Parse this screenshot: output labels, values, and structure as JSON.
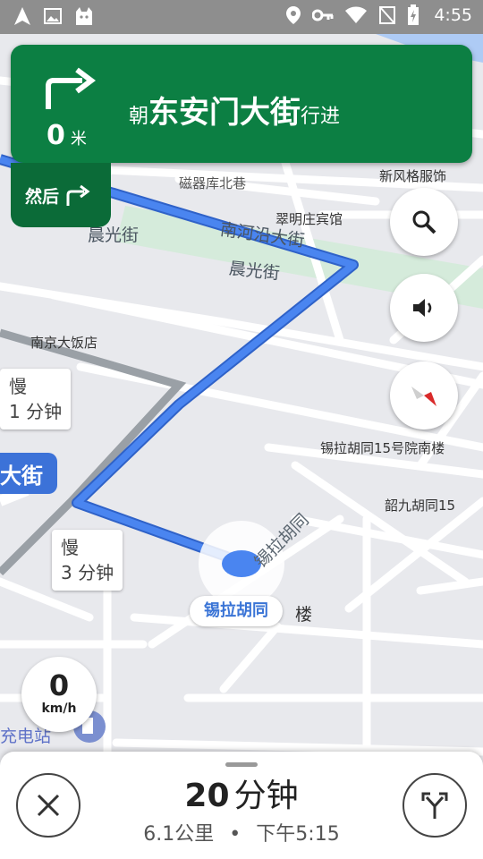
{
  "status_bar": {
    "time": "4:55",
    "left_icons": [
      "navigation-arrow-icon",
      "image-icon",
      "cat-app-icon"
    ],
    "right_icons": [
      "location-pin-icon",
      "key-icon",
      "wifi-icon",
      "no-sim-icon",
      "battery-charging-icon"
    ]
  },
  "banner": {
    "distance_value": "0",
    "distance_unit": "米",
    "instruction_prefix": "朝",
    "street": "东安门大街",
    "instruction_suffix": "行进",
    "then_label": "然后",
    "maneuver": "turn-right",
    "then_maneuver": "turn-right",
    "color": "#0c7f43"
  },
  "map": {
    "labels": {
      "dongcheng": "新风格服饰",
      "ciqiku": "磁器库北巷",
      "cuiming": "翠明庄宾馆",
      "chenguang1": "晨光街",
      "nanheyan": "南河沿大街",
      "chenguang2": "晨光街",
      "nanjing": "南京大饭店",
      "xilahutong15": "锡拉胡同15号院南楼",
      "shaojiu": "韶九胡同15",
      "hutong_diag": "锡拉胡同",
      "lou": "楼",
      "chongdian": "充电站",
      "tong": "同"
    },
    "route_color": "#4a85f0"
  },
  "callouts": {
    "first": {
      "line1": "慢",
      "line2": "1 分钟"
    },
    "second": {
      "line1": "慢",
      "line2": "3 分钟"
    }
  },
  "street_tag": "大街",
  "current_location_label": "锡拉胡同",
  "speedometer": {
    "value": "0",
    "unit": "km/h"
  },
  "bottom_sheet": {
    "eta_number": "20",
    "eta_unit": "分钟",
    "distance": "6.1公里",
    "separator": "•",
    "arrival": "下午5:15"
  }
}
